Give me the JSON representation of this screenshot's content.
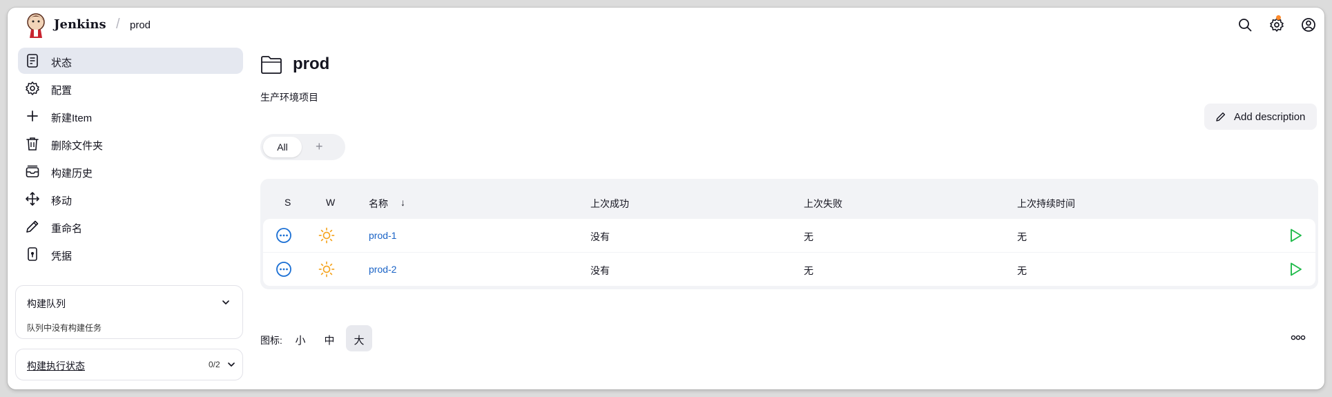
{
  "header": {
    "brand": "Jenkins",
    "separator": "/",
    "breadcrumb": "prod"
  },
  "sidebar": {
    "items": [
      {
        "label": "状态",
        "icon": "status-icon",
        "active": true
      },
      {
        "label": "配置",
        "icon": "gear-icon"
      },
      {
        "label": "新建Item",
        "icon": "plus-icon"
      },
      {
        "label": "删除文件夹",
        "icon": "trash-icon"
      },
      {
        "label": "构建历史",
        "icon": "history-icon"
      },
      {
        "label": "移动",
        "icon": "move-icon"
      },
      {
        "label": "重命名",
        "icon": "pencil-icon"
      },
      {
        "label": "凭据",
        "icon": "credentials-icon"
      }
    ],
    "build_queue": {
      "title": "构建队列",
      "empty_text": "队列中没有构建任务"
    },
    "executor_status": {
      "title": "构建执行状态",
      "count": "0/2"
    }
  },
  "main": {
    "title": "prod",
    "description": "生产环境项目",
    "add_description_label": "Add description",
    "tabs": {
      "all_label": "All",
      "add_label": "+"
    },
    "table": {
      "headers": {
        "s": "S",
        "w": "W",
        "name": "名称",
        "sort_arrow": "↓",
        "last_success": "上次成功",
        "last_failure": "上次失败",
        "last_duration": "上次持续时间"
      },
      "rows": [
        {
          "name": "prod-1",
          "last_success": "没有",
          "last_failure": "无",
          "last_duration": "无"
        },
        {
          "name": "prod-2",
          "last_success": "没有",
          "last_failure": "无",
          "last_duration": "无"
        }
      ]
    },
    "icon_size": {
      "label": "图标:",
      "small": "小",
      "medium": "中",
      "large": "大",
      "selected": "大"
    }
  },
  "colors": {
    "link": "#1a63c6",
    "status_blue": "#1a6fd4",
    "weather_sun": "#f5a623",
    "run_green": "#1fba4a",
    "notification": "#ff8a2b"
  }
}
